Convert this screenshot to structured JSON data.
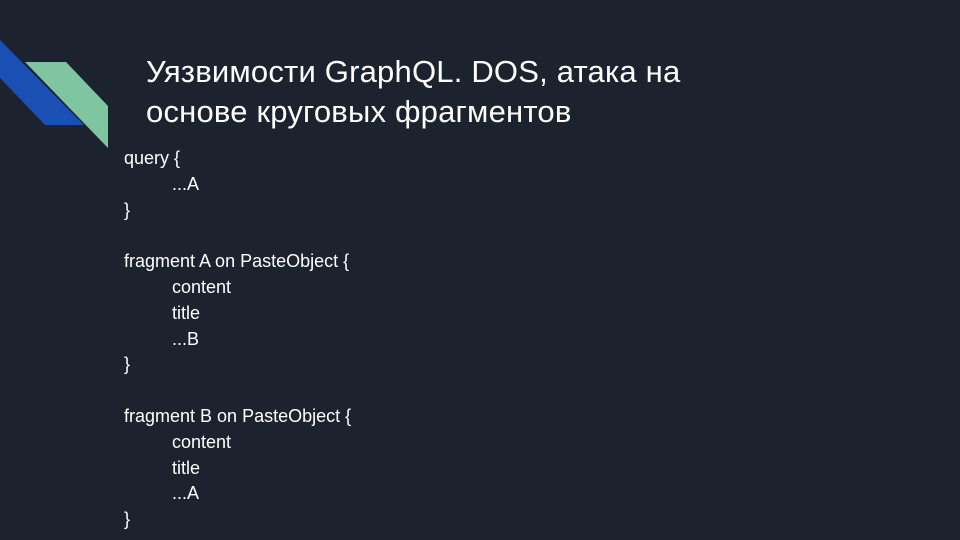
{
  "slide": {
    "title_line1": "Уязвимости GraphQL. DOS, атака на",
    "title_line2": "основе круговых фрагментов",
    "code_lines": [
      {
        "text": "query {",
        "indent": 0
      },
      {
        "text": "...A",
        "indent": 1
      },
      {
        "text": "}",
        "indent": 0
      },
      {
        "text": "",
        "indent": 0
      },
      {
        "text": "fragment A on PasteObject {",
        "indent": 0
      },
      {
        "text": "content",
        "indent": 1
      },
      {
        "text": "title",
        "indent": 1
      },
      {
        "text": "...B",
        "indent": 1
      },
      {
        "text": "}",
        "indent": 0
      },
      {
        "text": "",
        "indent": 0
      },
      {
        "text": "fragment B on PasteObject {",
        "indent": 0
      },
      {
        "text": "content",
        "indent": 1
      },
      {
        "text": "title",
        "indent": 1
      },
      {
        "text": "...A",
        "indent": 1
      },
      {
        "text": "}",
        "indent": 0
      }
    ]
  },
  "colors": {
    "background": "#1c222e",
    "accent_blue": "#1a4fb4",
    "accent_green": "#7fc5a2",
    "text": "#ffffff"
  }
}
